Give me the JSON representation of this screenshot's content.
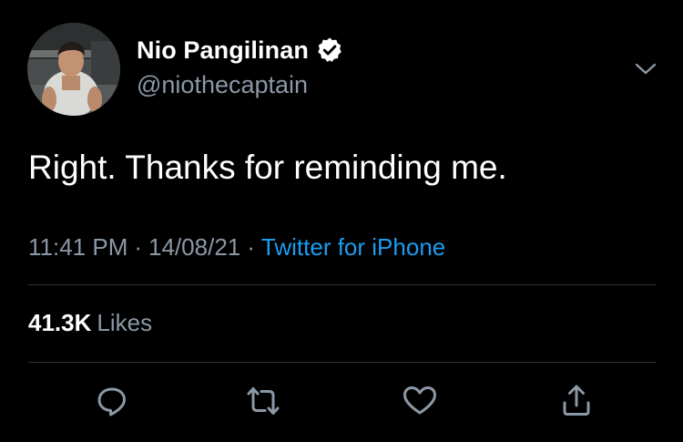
{
  "tweet": {
    "author": {
      "display_name": "Nio Pangilinan",
      "handle": "@niothecaptain",
      "verified": true
    },
    "text": "Right. Thanks for reminding me.",
    "time": "11:41 PM",
    "date": "14/08/21",
    "separator": "·",
    "source": "Twitter for iPhone",
    "likes": {
      "count": "41.3K",
      "label": "Likes"
    },
    "actions": [
      "reply-icon",
      "retweet-icon",
      "like-icon",
      "share-icon"
    ],
    "menu_icon": "chevron-down-icon"
  },
  "colors": {
    "background": "#000000",
    "primary_text": "#ffffff",
    "secondary_text": "#8b98a5",
    "accent": "#1d9bf0",
    "divider": "#2f3336"
  }
}
